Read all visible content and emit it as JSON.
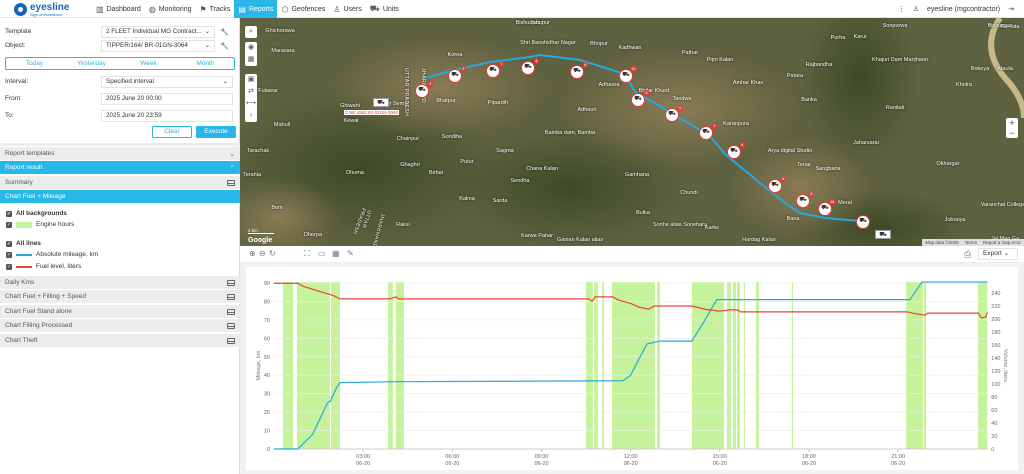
{
  "header": {
    "logo_text": "eyesline",
    "logo_tagline": "Sign of excellence",
    "nav": [
      {
        "label": "Dashboard",
        "icon": "bar-chart-icon"
      },
      {
        "label": "Monitoring",
        "icon": "globe-icon"
      },
      {
        "label": "Tracks",
        "icon": "flag-icon"
      },
      {
        "label": "Reports",
        "icon": "report-icon",
        "active": true
      },
      {
        "label": "Geofences",
        "icon": "geofence-icon"
      },
      {
        "label": "Users",
        "icon": "user-icon"
      },
      {
        "label": "Units",
        "icon": "bus-icon"
      }
    ],
    "menu_icon": "⋮",
    "user": "eyesline (mgcontractor)"
  },
  "form": {
    "template_label": "Template",
    "template_value": "2 FLEET Individual MG Contract...",
    "object_label": "Object:",
    "object_value": "TIPPER/164/ BR-01GN-3064",
    "tabs": [
      "Today",
      "Yesterday",
      "Week",
      "Month"
    ],
    "interval_label": "Interval:",
    "interval_value": "Specified interval",
    "from_label": "From:",
    "from_value": "2025 June 20 00:00",
    "to_label": "To:",
    "to_value": "2025 June 20 23:59",
    "clear": "Clear",
    "execute": "Execute"
  },
  "sections": {
    "report_templates": "Report templates",
    "report_result": "Report result",
    "summary": "Summary",
    "chart_fuel_mileage": "Chart Fuel + Mileage",
    "legend": {
      "all_backgrounds": "All backgrounds",
      "engine_hours": "Engine hours",
      "all_lines": "All lines",
      "mileage": "Absolute mileage, km",
      "fuel": "Fuel level, liters"
    },
    "others": [
      "Daily Kms",
      "Chart Fuel + Filling + Speed",
      "Chart Fuel Stand alone",
      "Chart Filling Processed",
      "Chart Theft"
    ]
  },
  "map": {
    "places": [
      "Ghichorawa",
      "Marasara",
      "Fulawar",
      "Mahuli",
      "Ghiwahi",
      "Kewal",
      "Nuri Semai",
      "Bhatpur",
      "Korea",
      "Pipardih",
      "Bishunpur",
      "Shri Banshidhar Nagar",
      "Bhopur",
      "Kadhwan",
      "Adhaura",
      "Adhauri",
      "Bhitar Khurd",
      "Tandwa",
      "Pathar",
      "Pipri Kalan",
      "Amhar Khas",
      "Karanpura",
      "Bamba dam, Bamba",
      "Chainpur",
      "Sondiha",
      "Sagma",
      "Ghaghri",
      "Putur",
      "Birbai",
      "Dhuma",
      "Kalma",
      "Sarda",
      "Bom",
      "Dhorpa",
      "Raksi",
      "Tarachak",
      "Terahia",
      "Chana Kalan",
      "Sendha",
      "Gamhana",
      "Chundi",
      "Bulka",
      "Sonhe alias Sonehara",
      "Karke",
      "Karwa Pahar",
      "Ganian Kalan alias",
      "Hardag Kalan",
      "Sonpurwa",
      "Purha",
      "Karui",
      "Rajbandha",
      "Patara",
      "Banka",
      "Ranitali",
      "Khajuri Dam Manjhaon",
      "Bokeya",
      "Ataula",
      "Kholra",
      "Karkata",
      "Jaharsarai",
      "Arya digital Studio",
      "Tenar",
      "Sangbaria",
      "Okhargar",
      "Meral",
      "Bana",
      "Jobraiya",
      "Varanchal College",
      "Jai Maa Ga",
      "Jahupur",
      "Bishunpur"
    ],
    "regions": [
      "UTTAR PRADESH",
      "JHARKHAND",
      "UTTAR PRADESH",
      "JHARKHAND"
    ],
    "plate": "CAB/ 4562 BJ-01GN-3064",
    "marker_counts": [
      "2",
      "5",
      "7",
      "4",
      "8",
      "10",
      "5",
      "6",
      "3",
      "4",
      "6",
      "8",
      "16"
    ],
    "attribution": [
      "Map data ©2025",
      "Terms",
      "Report a map error"
    ],
    "google": "Google",
    "scale": "2 km"
  },
  "chart_toolbar": {
    "export": "Export"
  },
  "chart_data": {
    "type": "line",
    "xlabel": "",
    "ylabel": "Mileage, km",
    "y2label": "Volume, liters",
    "xlim": [
      0,
      24
    ],
    "ylim": [
      0,
      90
    ],
    "y2lim": [
      0,
      255
    ],
    "x_ticks": [
      {
        "h": 3,
        "label": "03:00",
        "date": "06-20"
      },
      {
        "h": 6,
        "label": "06:00",
        "date": "06-20"
      },
      {
        "h": 9,
        "label": "09:00",
        "date": "06-20"
      },
      {
        "h": 12,
        "label": "12:00",
        "date": "06-20"
      },
      {
        "h": 15,
        "label": "15:00",
        "date": "06-20"
      },
      {
        "h": 18,
        "label": "18:00",
        "date": "06-20"
      },
      {
        "h": 21,
        "label": "21:00",
        "date": "06-20"
      }
    ],
    "y_ticks": [
      0,
      10,
      20,
      30,
      40,
      50,
      60,
      70,
      80,
      90
    ],
    "y2_ticks": [
      0,
      20,
      40,
      60,
      80,
      100,
      120,
      140,
      160,
      180,
      200,
      220,
      240
    ],
    "series": [
      {
        "name": "Absolute mileage, km",
        "axis": "left",
        "color": "#29a8e0",
        "points": [
          [
            0,
            0
          ],
          [
            0.8,
            0
          ],
          [
            1.3,
            8
          ],
          [
            1.8,
            25
          ],
          [
            1.9,
            26
          ],
          [
            2.1,
            33
          ],
          [
            2.22,
            36
          ],
          [
            4.2,
            36.5
          ],
          [
            11.74,
            37
          ],
          [
            12.0,
            40
          ],
          [
            12.32,
            50
          ],
          [
            12.55,
            57
          ],
          [
            12.99,
            58.5
          ],
          [
            14.06,
            58.5
          ],
          [
            14.43,
            68
          ],
          [
            14.9,
            81
          ],
          [
            21.4,
            81
          ],
          [
            21.8,
            90.5
          ],
          [
            24,
            90.5
          ]
        ]
      },
      {
        "name": "Fuel level, liters",
        "axis": "right",
        "color": "#e8463c",
        "points": [
          [
            0,
            255
          ],
          [
            0.8,
            255
          ],
          [
            1.0,
            250
          ],
          [
            1.5,
            243
          ],
          [
            2.0,
            236
          ],
          [
            2.22,
            231
          ],
          [
            3.9,
            231
          ],
          [
            4.1,
            234
          ],
          [
            4.2,
            231
          ],
          [
            10.6,
            231
          ],
          [
            10.7,
            227
          ],
          [
            10.8,
            234
          ],
          [
            11.4,
            234
          ],
          [
            11.6,
            229
          ],
          [
            12.0,
            224
          ],
          [
            12.3,
            218
          ],
          [
            12.6,
            215
          ],
          [
            12.8,
            220
          ],
          [
            14.06,
            220
          ],
          [
            14.5,
            215
          ],
          [
            15.0,
            212
          ],
          [
            15.3,
            214
          ],
          [
            15.6,
            214
          ],
          [
            15.7,
            211
          ],
          [
            21.3,
            211
          ],
          [
            21.6,
            208
          ],
          [
            21.9,
            206
          ],
          [
            22.0,
            209
          ],
          [
            23.7,
            209
          ],
          [
            23.8,
            202
          ],
          [
            23.95,
            203
          ],
          [
            24,
            210
          ]
        ]
      }
    ],
    "engine_hours": [
      [
        0.3,
        0.64
      ],
      [
        0.77,
        1.88
      ],
      [
        1.92,
        2.22
      ],
      [
        3.84,
        4.0
      ],
      [
        4.1,
        4.37
      ],
      [
        10.5,
        10.73
      ],
      [
        10.77,
        10.9
      ],
      [
        11.04,
        11.1
      ],
      [
        11.37,
        12.82
      ],
      [
        12.89,
        12.99
      ],
      [
        14.06,
        15.14
      ],
      [
        15.24,
        15.38
      ],
      [
        15.44,
        15.55
      ],
      [
        15.58,
        15.68
      ],
      [
        15.81,
        15.85
      ],
      [
        16.22,
        16.32
      ],
      [
        17.43,
        17.46
      ],
      [
        21.27,
        21.84
      ],
      [
        21.87,
        21.94
      ],
      [
        23.69,
        24
      ]
    ],
    "engine_color": "#c5f29a",
    "grid": true,
    "legend": "left-panel"
  }
}
